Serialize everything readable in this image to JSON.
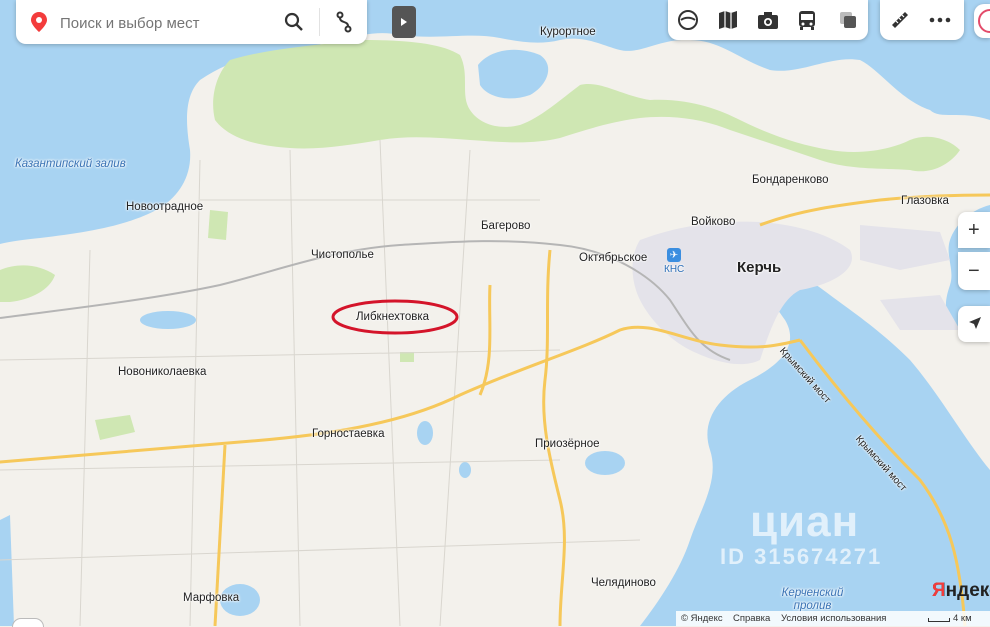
{
  "search": {
    "placeholder": "Поиск и выбор мест"
  },
  "labels": {
    "kazantip_bay": "Казантипский залив",
    "kurortnoe": "Курортное",
    "novootradnoe": "Новоотрадное",
    "chistopole": "Чистополье",
    "bagerovo": "Багерово",
    "voykovo": "Войково",
    "bondarenkovo": "Бондаренково",
    "glazovka": "Глазовка",
    "oktyabrskoe": "Октябрьское",
    "kns": "КНС",
    "kerch": "Керчь",
    "libknekhtovka": "Либкнехтовка",
    "novonikolaevka": "Новониколаевка",
    "gornostaevka": "Горностаевка",
    "priozernoe": "Приозёрное",
    "crimean_bridge_1": "Крымский мост",
    "crimean_bridge_2": "Крымский мост",
    "marfovka": "Марфовка",
    "chelyadinovo": "Челядиново",
    "kerch_strait": "Керченский пролив"
  },
  "watermark": {
    "brand": "циан",
    "id": "ID 315674271"
  },
  "brand_logo": "Яндекс",
  "footer": {
    "copyright": "© Яндекс",
    "help": "Справка",
    "terms": "Условия использования",
    "scale": "4 км"
  },
  "zoom": {
    "plus": "+",
    "minus": "−"
  },
  "colors": {
    "water": "#a8d3f2",
    "land": "#f3f1ec",
    "forest": "#cfe7b3",
    "urban": "#e6e6ea",
    "highway": "#f6c85a",
    "railway": "#b5b5b5",
    "highlight_ellipse": "#d4142a",
    "pin": "#f33c3c"
  },
  "icons": [
    "map-pin-icon",
    "search-icon",
    "route-icon",
    "collapse-arrow-icon",
    "layers-icon",
    "panorama-icon",
    "photo-icon",
    "transport-icon",
    "map-type-icon",
    "ruler-icon",
    "more-icon",
    "airport-icon",
    "locate-icon"
  ]
}
